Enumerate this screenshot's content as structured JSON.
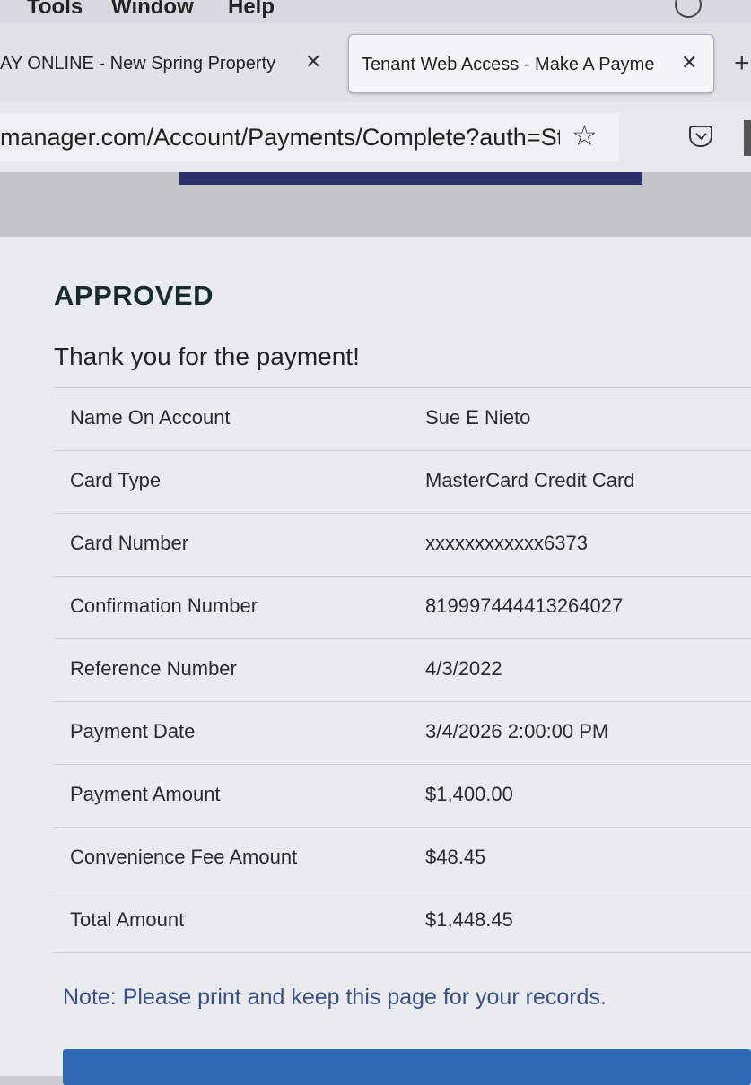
{
  "menubar": {
    "items": [
      "Tools",
      "Window",
      "Help"
    ]
  },
  "tabs": [
    {
      "title": "AY ONLINE - New Spring Property",
      "close_glyph": "✕"
    },
    {
      "title": "Tenant Web Access - Make A Payme",
      "close_glyph": "✕"
    }
  ],
  "new_tab_glyph": "+",
  "address_bar": {
    "url": "manager.com/Account/Payments/Complete?auth=St",
    "bookmark_glyph": "☆"
  },
  "receipt": {
    "status": "APPROVED",
    "message": "Thank you for the payment!",
    "rows": [
      {
        "label": "Name On Account",
        "value": "Sue E Nieto"
      },
      {
        "label": "Card Type",
        "value": "MasterCard Credit Card"
      },
      {
        "label": "Card Number",
        "value": "xxxxxxxxxxxx6373"
      },
      {
        "label": "Confirmation Number",
        "value": "819997444413264027"
      },
      {
        "label": "Reference Number",
        "value": "4/3/2022"
      },
      {
        "label": "Payment Date",
        "value": "3/4/2026 2:00:00 PM"
      },
      {
        "label": "Payment Amount",
        "value": "$1,400.00"
      },
      {
        "label": "Convenience Fee Amount",
        "value": "$48.45"
      },
      {
        "label": "Total Amount",
        "value": "$1,448.45"
      }
    ],
    "note": "Note: Please print and keep this page for your records."
  },
  "colors": {
    "progress_bar": "#2b2f6a",
    "note_text": "#3b4f86",
    "print_button": "#2f69b3"
  },
  "icons": {
    "history": "history-icon",
    "bookmark": "star-icon",
    "pocket": "pocket-icon"
  }
}
